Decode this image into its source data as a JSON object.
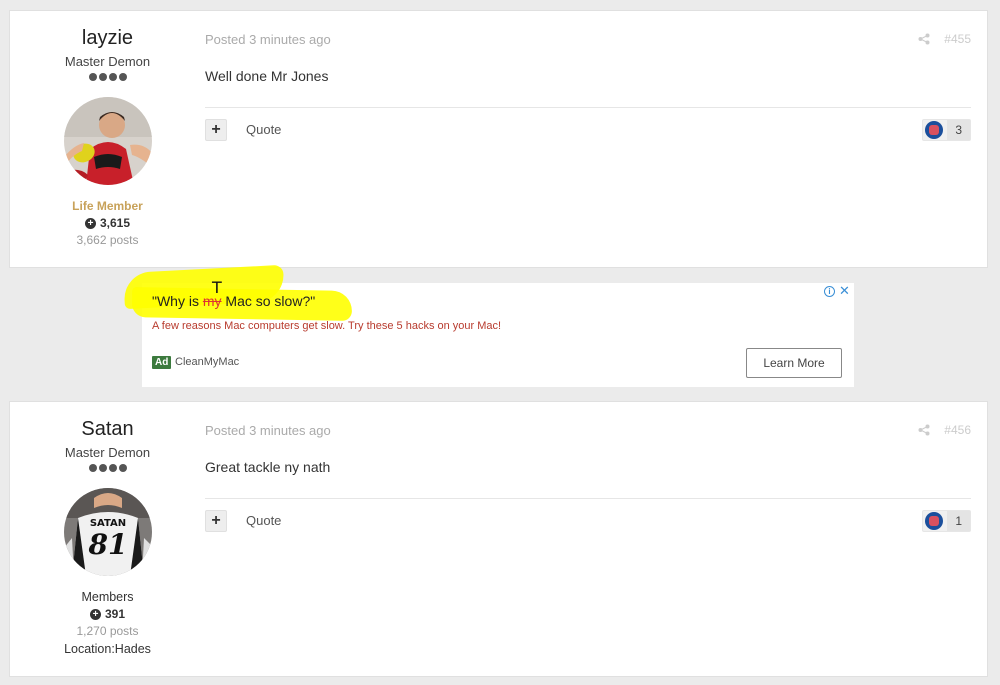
{
  "posts": [
    {
      "author": "layzie",
      "title": "Master Demon",
      "group": "Life Member",
      "reputation": "3,615",
      "post_count": "3,662 posts",
      "location": "",
      "meta": "Posted 3 minutes ago",
      "post_number": "#455",
      "content": "Well done Mr Jones",
      "quote_label": "Quote",
      "plus_label": "+",
      "reaction_count": "3"
    },
    {
      "author": "Satan",
      "title": "Master Demon",
      "group": "Members",
      "reputation": "391",
      "post_count": "1,270 posts",
      "location": "Location:Hades",
      "meta": "Posted 3 minutes ago",
      "post_number": "#456",
      "content": "Great tackle ny nath",
      "quote_label": "Quote",
      "plus_label": "+",
      "reaction_count": "1",
      "jersey_text": "SATAN",
      "jersey_number": "81"
    }
  ],
  "ad": {
    "headline_pre": "\"Why is ",
    "headline_struck": "my",
    "headline_post": " Mac so slow?\"",
    "handwritten_mark": "T",
    "description": "A few reasons Mac computers get slow. Try these 5 hacks on your Mac!",
    "badge": "Ad",
    "advertiser": "CleanMyMac",
    "cta": "Learn More"
  },
  "colors": {
    "background": "#ebebeb",
    "life_member": "#c8a25a",
    "highlight": "#ffff00",
    "ad_description": "#b83b2e",
    "ad_badge": "#3c7a3e",
    "ad_info": "#3a8fd6"
  }
}
